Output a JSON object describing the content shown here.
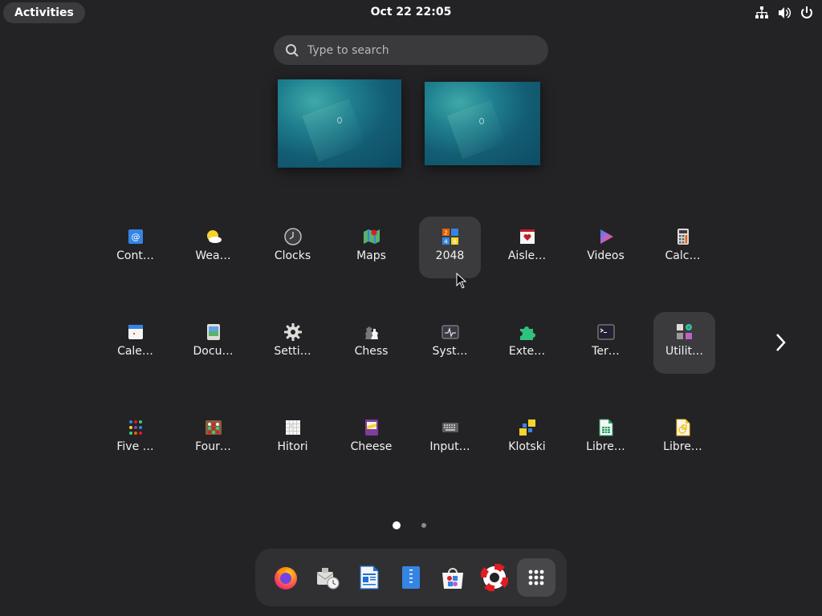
{
  "topbar": {
    "activities_label": "Activities",
    "clock": "Oct 22  22:05",
    "status_icons": [
      "network-icon",
      "volume-icon",
      "power-icon"
    ]
  },
  "search": {
    "placeholder": "Type to search",
    "icon": "search-icon"
  },
  "workspaces": [
    {
      "name": "workspace-1"
    },
    {
      "name": "workspace-2"
    }
  ],
  "app_grid": {
    "rows": [
      [
        {
          "label": "Cont…",
          "icon": "contacts-icon"
        },
        {
          "label": "Wea…",
          "icon": "weather-icon"
        },
        {
          "label": "Clocks",
          "icon": "clocks-icon"
        },
        {
          "label": "Maps",
          "icon": "maps-icon"
        },
        {
          "label": "2048",
          "icon": "game-2048-icon"
        },
        {
          "label": "Aisle…",
          "icon": "aisleriot-icon"
        },
        {
          "label": "Videos",
          "icon": "videos-icon"
        },
        {
          "label": "Calc…",
          "icon": "calculator-icon"
        }
      ],
      [
        {
          "label": "Cale…",
          "icon": "calendar-icon"
        },
        {
          "label": "Docu…",
          "icon": "document-viewer-icon"
        },
        {
          "label": "Setti…",
          "icon": "settings-icon"
        },
        {
          "label": "Chess",
          "icon": "chess-icon"
        },
        {
          "label": "Syst…",
          "icon": "system-monitor-icon"
        },
        {
          "label": "Exte…",
          "icon": "extensions-icon"
        },
        {
          "label": "Ter…",
          "icon": "terminal-icon"
        },
        {
          "label": "Utilit…",
          "icon": "utilities-folder-icon"
        }
      ],
      [
        {
          "label": "Five …",
          "icon": "five-or-more-icon"
        },
        {
          "label": "Four…",
          "icon": "four-in-a-row-icon"
        },
        {
          "label": "Hitori",
          "icon": "hitori-icon"
        },
        {
          "label": "Cheese",
          "icon": "cheese-icon"
        },
        {
          "label": "Input…",
          "icon": "input-method-icon"
        },
        {
          "label": "Klotski",
          "icon": "klotski-icon"
        },
        {
          "label": "Libre…",
          "icon": "libreoffice-calc-icon"
        },
        {
          "label": "Libre…",
          "icon": "libreoffice-draw-icon"
        }
      ]
    ],
    "highlighted": [
      "2048",
      "Utilit…"
    ],
    "next_page_icon": "chevron-right-icon"
  },
  "pagination": {
    "pages": 2,
    "current": 1
  },
  "dash": {
    "items": [
      {
        "name": "firefox-icon"
      },
      {
        "name": "evolution-mail-icon"
      },
      {
        "name": "libreoffice-writer-icon"
      },
      {
        "name": "text-editor-icon"
      },
      {
        "name": "software-icon"
      },
      {
        "name": "help-icon"
      },
      {
        "name": "show-apps-icon",
        "active": true
      }
    ]
  },
  "colors": {
    "background": "#232326",
    "panel": "#3b3b3e",
    "accent_blue": "#3584e4"
  }
}
